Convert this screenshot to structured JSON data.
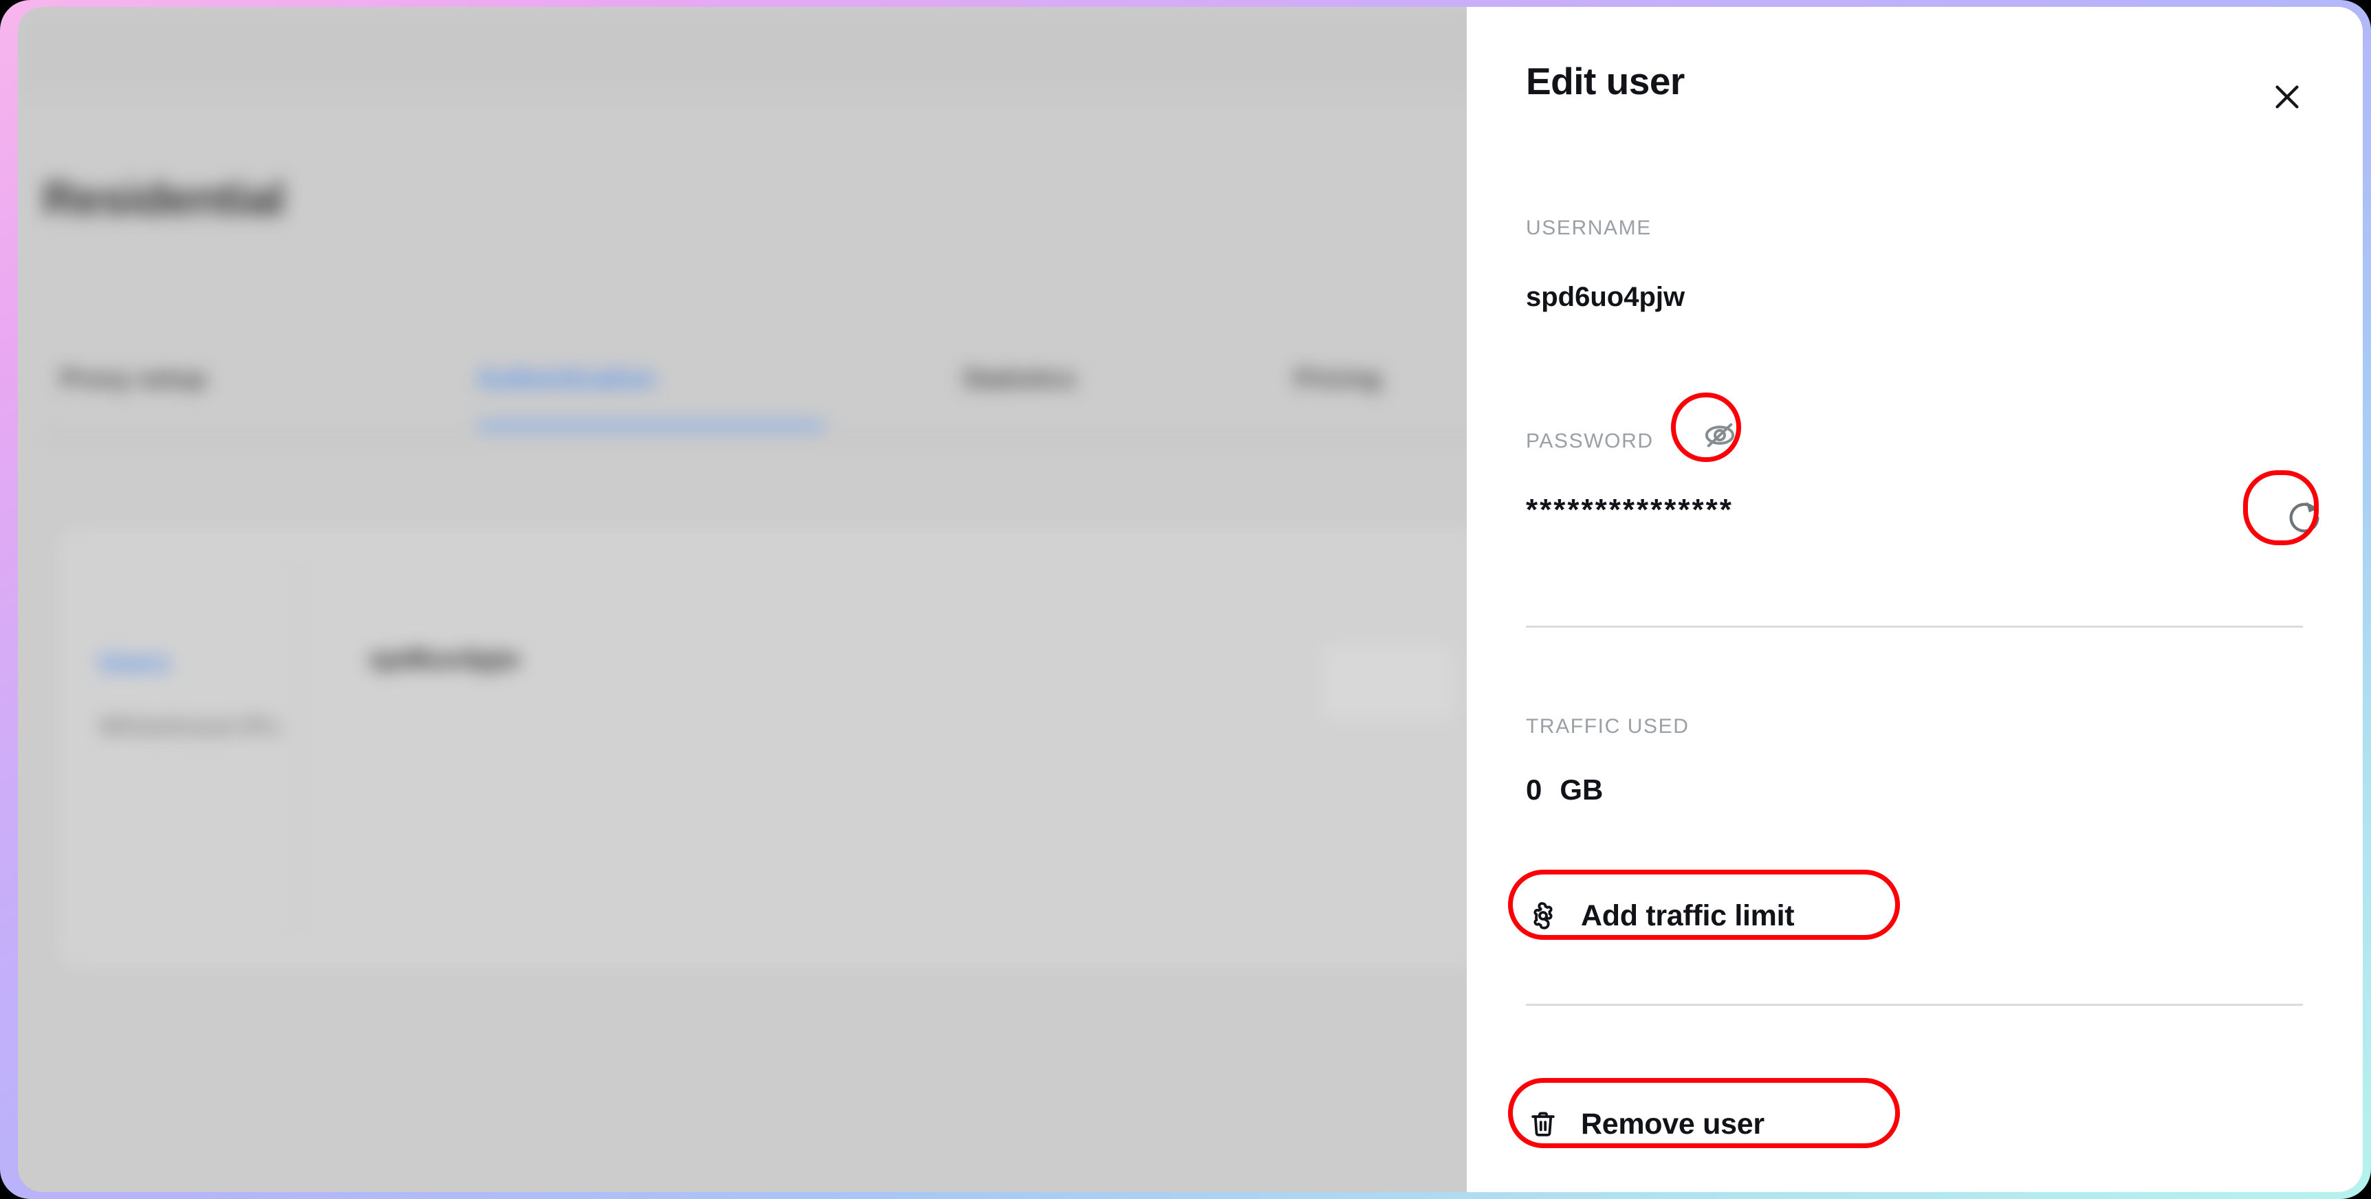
{
  "background_app": {
    "page_title": "Residential",
    "tabs": [
      {
        "label": "Proxy setup",
        "active": false
      },
      {
        "label": "Authentication",
        "active": true
      },
      {
        "label": "Statistics",
        "active": false
      },
      {
        "label": "Pricing",
        "active": false
      }
    ],
    "side_nav": [
      {
        "label": "Users",
        "active": true
      },
      {
        "label": "Whitelisted IPs",
        "active": false
      }
    ],
    "card_user": "spd6uo4pjw"
  },
  "panel": {
    "title": "Edit user",
    "close_icon": "close-icon",
    "username": {
      "label": "USERNAME",
      "value": "spd6uo4pjw"
    },
    "password": {
      "label": "PASSWORD",
      "value": "***************",
      "visibility_icon": "eye-off-icon",
      "regenerate_icon": "refresh-icon"
    },
    "traffic": {
      "label": "TRAFFIC USED",
      "amount": "0",
      "unit": "GB"
    },
    "actions": [
      {
        "label": "Add traffic limit",
        "icon": "gear-icon"
      },
      {
        "label": "Remove user",
        "icon": "trash-icon"
      }
    ]
  },
  "annotations": {
    "color": "#fb0007",
    "targets": [
      "toggle-password-visibility",
      "regenerate-password",
      "add-traffic-limit",
      "remove-user"
    ]
  },
  "theme": {
    "frame_gradient_start": "#f7b6ec",
    "frame_gradient_mid": "#b6b4fb",
    "frame_gradient_end": "#b5f3ee",
    "panel_background": "#ffffff",
    "page_background": "#cccccc",
    "accent_blue": "#4f8ef0",
    "text_primary": "#111318",
    "text_muted": "#9aa0a6"
  }
}
